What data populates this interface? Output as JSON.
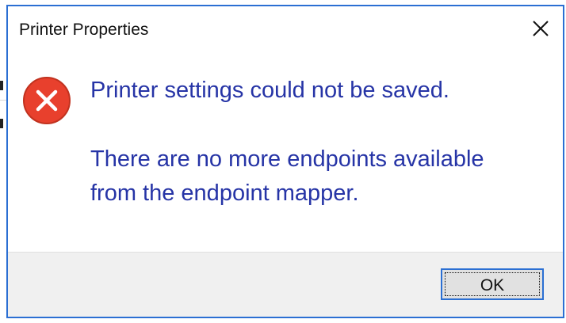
{
  "window": {
    "title": "Printer Properties",
    "close_icon": "close-icon"
  },
  "error": {
    "icon": "error-icon",
    "icon_color": "#e8402d",
    "main_instruction": "Printer settings could not be saved.",
    "detail_line1": "There are no more endpoints available",
    "detail_line2": "from the endpoint mapper."
  },
  "buttons": {
    "ok_label": "OK"
  },
  "colors": {
    "accent": "#2b6fd3",
    "message_text": "#2634a6",
    "footer_bg": "#f0f0f0"
  }
}
